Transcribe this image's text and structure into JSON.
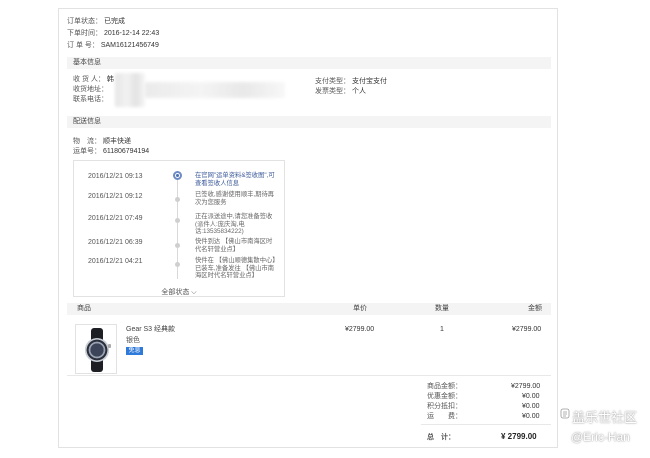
{
  "order": {
    "status_label": "订单状态：",
    "status_value": "已完成",
    "time_label": "下单时间：",
    "time_value": "2016-12-14 22:43",
    "number_label": "订 单 号：",
    "number_value": "SAM16121456749"
  },
  "basic_info": {
    "title": "基本信息",
    "recipient_label": "收 货 人：",
    "recipient_value": "韩",
    "address_label": "收货地址：",
    "phone_label": "联系电话：",
    "payment_label": "支付类型：",
    "payment_value": "支付宝支付",
    "invoice_label": "发票类型：",
    "invoice_value": "个人"
  },
  "delivery": {
    "title": "配送信息",
    "logistics_label": "物　流：",
    "logistics_value": "顺丰快递",
    "tracking_label": "运单号：",
    "tracking_value": "611806794194",
    "timeline": [
      {
        "time": "2016/12/21 09:13",
        "desc": "在官网\"运单资料&签收图\",可查看签收人信息"
      },
      {
        "time": "2016/12/21 09:12",
        "desc": "已签收,感谢使用顺丰,期待再次为您服务"
      },
      {
        "time": "2016/12/21 07:49",
        "desc": "正在派送途中,请您准备签收(派件人:庞庆淘,电话:13535834222)"
      },
      {
        "time": "2016/12/21 06:39",
        "desc": "快件到达 【佛山市南海区时代名轩营业点】"
      },
      {
        "time": "2016/12/21 04:21",
        "desc": "快件在 【佛山顺德集散中心】已装车,准备发往 【佛山市南海区时代名轩营业点】"
      }
    ],
    "more_label": "全部状态 ⌵"
  },
  "table": {
    "headers": {
      "product": "商品",
      "price": "单价",
      "qty": "数量",
      "amount": "金额"
    },
    "items": [
      {
        "name": "Gear S3 经典款",
        "color": "银色",
        "badge": "免息",
        "price": "¥2799.00",
        "qty": "1",
        "amount": "¥2799.00"
      }
    ]
  },
  "summary": {
    "goods_label": "商品金额：",
    "goods_value": "¥2799.00",
    "discount_label": "优惠金额：",
    "discount_value": "¥0.00",
    "points_label": "积分抵扣：",
    "points_value": "¥0.00",
    "shipping_label": "运　　费：",
    "shipping_value": "¥0.00",
    "total_label": "总　计：",
    "total_value": "¥ 2799.00"
  },
  "watermark": {
    "line1": "盖乐世社区",
    "line2": "@Eric-Han"
  },
  "colors": {
    "accent": "#2f7ad9",
    "timeline_active": "#3c5a9a",
    "section_bg": "#f4f4f4"
  }
}
